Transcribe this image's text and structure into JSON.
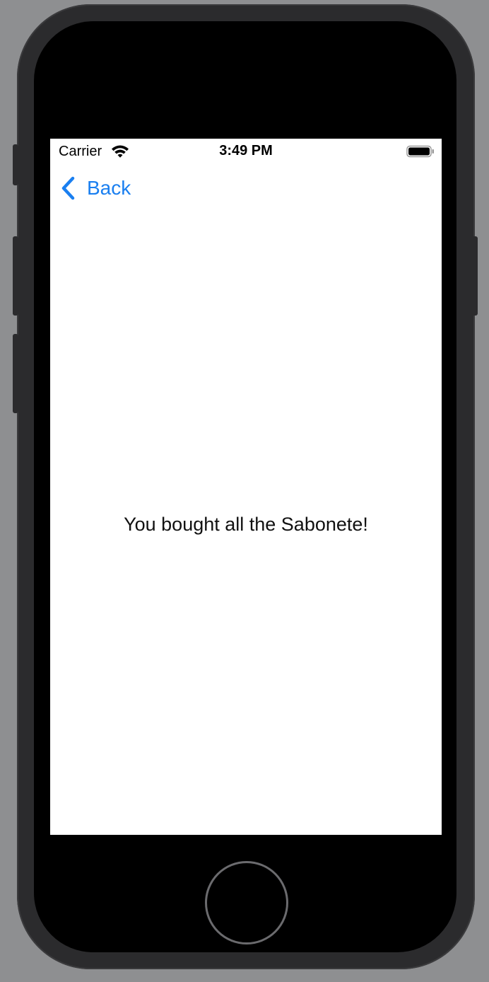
{
  "status_bar": {
    "carrier": "Carrier",
    "time": "3:49 PM",
    "wifi_icon": "wifi-icon",
    "battery_icon": "battery-icon"
  },
  "nav": {
    "back_label": "Back",
    "back_icon": "chevron-left-icon"
  },
  "content": {
    "message": "You bought all the Sabonete!"
  },
  "colors": {
    "accent": "#1a7ff0",
    "screen_background": "#ffffff",
    "device_frame": "#2b2b2d"
  }
}
